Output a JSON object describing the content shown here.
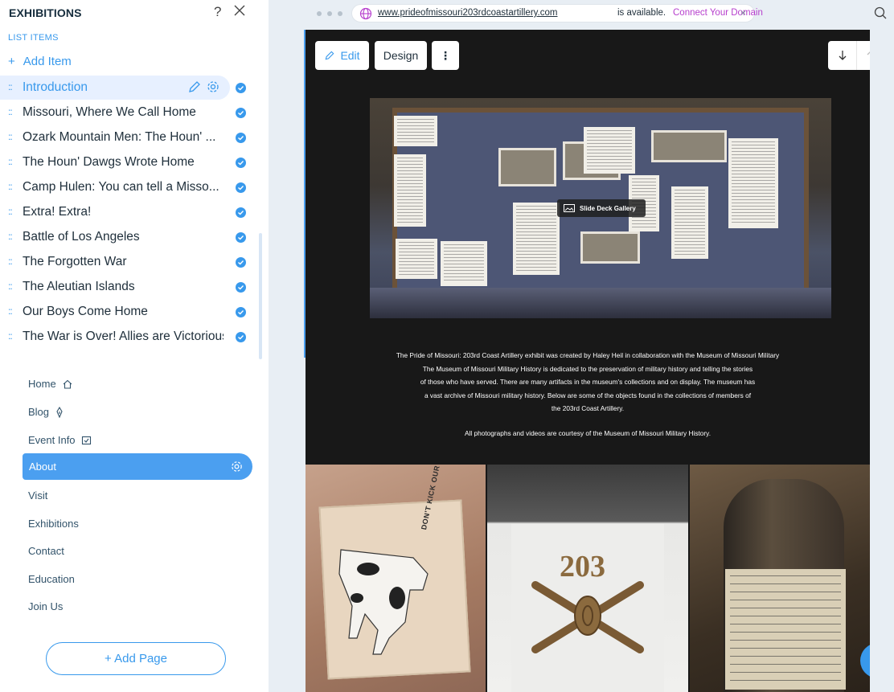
{
  "exhibitions_panel": {
    "title": "EXHIBITIONS",
    "help_glyph": "?",
    "section_label": "LIST ITEMS",
    "add_item": "Add Item",
    "items": [
      {
        "label": "Introduction",
        "selected": true
      },
      {
        "label": "Missouri, Where We Call Home"
      },
      {
        "label": "Ozark Mountain Men: The Houn' ..."
      },
      {
        "label": "The Houn' Dawgs Wrote Home"
      },
      {
        "label": "Camp Hulen: You can tell a Misso..."
      },
      {
        "label": "Extra! Extra!"
      },
      {
        "label": "Battle of Los Angeles"
      },
      {
        "label": "The Forgotten War"
      },
      {
        "label": "The Aleutian Islands"
      },
      {
        "label": "Our Boys Come Home"
      },
      {
        "label": "The War is Over! Allies are Victorious"
      }
    ]
  },
  "pages_panel": {
    "pages": [
      {
        "label": "Home",
        "icon": "home-icon"
      },
      {
        "label": "Blog",
        "icon": "blog-pen-icon"
      },
      {
        "label": "Event Info",
        "icon": "calendar-icon"
      },
      {
        "label": "About",
        "selected": true
      },
      {
        "label": "Visit"
      },
      {
        "label": "Exhibitions"
      },
      {
        "label": "Contact"
      },
      {
        "label": "Education"
      },
      {
        "label": "Join Us"
      }
    ],
    "add_page": "+ Add Page"
  },
  "browser": {
    "url": "www.prideofmissouri203rdcoastartillery.com",
    "status": "is available.",
    "connect_link": "Connect Your Domain",
    "close_glyph": "×"
  },
  "toolbar": {
    "edit": "Edit",
    "design": "Design",
    "more": "⋮"
  },
  "site": {
    "gallery_chip": "Slide Deck Gallery",
    "description": [
      "The Pride of Missouri: 203rd Coast Artillery exhibit was created by Haley Heil in collaboration with the Museum of Missouri Military",
      "The Museum of Missouri Military History is dedicated to the preservation of military history and telling the stories",
      "of those who have served. There are many artifacts in the museum's collections and on display. The museum has",
      "a vast archive of Missouri military history. Below are some of the objects found in the collections of members of",
      "the 203rd Coast Artillery."
    ],
    "credit": "All photographs and videos are courtesy of the Museum of Missouri Military History.",
    "tile1_text": "DON'T KICK OUR DOG",
    "tile2_text": "203",
    "help_glyph": "?"
  },
  "colors": {
    "accent": "#3899ec",
    "connect": "#b63ecd",
    "canvas_bg": "#181818",
    "selected_row_bg": "#e7f0ff"
  }
}
